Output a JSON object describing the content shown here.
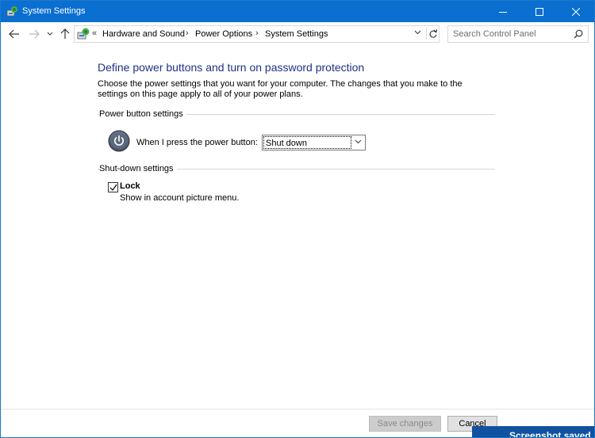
{
  "window": {
    "title": "System Settings",
    "titlebar_color": "#0a6fd1"
  },
  "navbar": {
    "breadcrumb_overflow": "«",
    "breadcrumb": [
      "Hardware and Sound",
      "Power Options",
      "System Settings"
    ],
    "separator": "›",
    "search_placeholder": "Search Control Panel"
  },
  "main": {
    "heading": "Define power buttons and turn on password protection",
    "description": "Choose the power settings that you want for your computer. The changes that you make to the settings on this page apply to all of your power plans.",
    "power_group": {
      "label": "Power button settings",
      "row_label": "When I press the power button:",
      "selected_option": "Shut down"
    },
    "shutdown_group": {
      "label": "Shut-down settings",
      "lock": {
        "checked": true,
        "label": "Lock",
        "description": "Show in account picture menu."
      }
    }
  },
  "footer": {
    "save_label": "Save changes",
    "save_enabled": false,
    "cancel_label": "Cancel"
  },
  "toast": {
    "text": "Screenshot saved"
  },
  "colors": {
    "heading": "#1e3287",
    "accent": "#0a6fd1",
    "toast_bg": "#1052a0"
  },
  "icons": {
    "app": "control-panel-icon",
    "back": "arrow-left-icon",
    "forward": "arrow-right-icon",
    "recent": "chevron-down-icon",
    "up": "arrow-up-icon",
    "refresh": "refresh-icon",
    "search": "search-icon",
    "power": "power-icon"
  }
}
